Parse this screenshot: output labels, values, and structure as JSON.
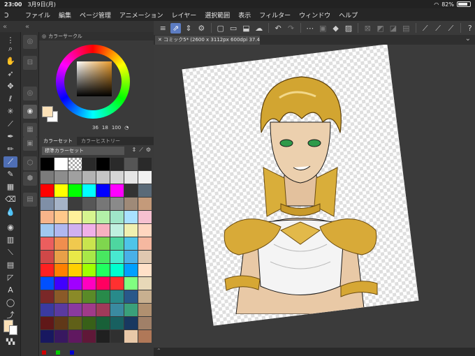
{
  "status": {
    "time": "23:00",
    "date": "3月9日(月)",
    "battery": "82%",
    "battery_level": 0.82
  },
  "menu": [
    "ファイル",
    "編集",
    "ページ管理",
    "アニメーション",
    "レイヤー",
    "選択範囲",
    "表示",
    "フィルター",
    "ウィンドウ",
    "ヘルプ"
  ],
  "tab": {
    "title": "コミック5* (2600 x 3112px 600dpi 37.4%)"
  },
  "color_wheel": {
    "title": "カラーサークル",
    "values": [
      "36",
      "18",
      "100"
    ]
  },
  "color_set": {
    "tabs": [
      "カラーセット",
      "カラーヒストリー"
    ],
    "selected_set": "標準カラーセット",
    "swatches": [
      "#000000",
      "#ffffff",
      "checker",
      "#2a2a2a",
      "#000000",
      "#2a2a2a",
      "#555555",
      "#2a2a2a",
      "#7b7b7b",
      "#8d8d8d",
      "#a0a0a0",
      "#b3b3b3",
      "#c6c6c6",
      "#d6d6d6",
      "#e6e6e6",
      "#f2f2f2",
      "#ff0000",
      "#ffff00",
      "#00ff00",
      "#00ffff",
      "#0000ff",
      "#ff00ff",
      "#333333",
      "#5a6a78",
      "#7f8fa7",
      "#a5b3c7",
      "#3d3d3d",
      "#575757",
      "#777777",
      "#8a8a8a",
      "#9f8a78",
      "#c49a7a",
      "#f7b48a",
      "#ffc88a",
      "#fff09a",
      "#d6f58f",
      "#b3f0a8",
      "#9fe6c8",
      "#a8e1ff",
      "#f6c0d0",
      "#a0c8f0",
      "#b0b8f0",
      "#d0b0f0",
      "#f0b0e8",
      "#f7b0c0",
      "#c0f0e0",
      "#f0f0b0",
      "#ffd6c0",
      "#ec5e5e",
      "#f08e4e",
      "#f0c94e",
      "#c9e44e",
      "#7fd64e",
      "#4ed6a0",
      "#4ec4e8",
      "#f5b8a0",
      "#d04848",
      "#e8a048",
      "#e8e848",
      "#a8e848",
      "#48e860",
      "#48e8d0",
      "#48b0e8",
      "#e0c8b0",
      "#ff2020",
      "#ff8000",
      "#ffd000",
      "#a0ff00",
      "#20ff60",
      "#00ffd0",
      "#00a0ff",
      "#ffe0c8",
      "#0050ff",
      "#4000ff",
      "#a000ff",
      "#ff00c0",
      "#ff0060",
      "#ff3030",
      "#80ff80",
      "#e8d8b8",
      "#7a2828",
      "#8a5a28",
      "#8a8a28",
      "#5a8a28",
      "#288a4a",
      "#288a8a",
      "#28588a",
      "#c8b090",
      "#3a3aa0",
      "#5a3aa0",
      "#8a3aa0",
      "#a03a8a",
      "#a03a5a",
      "#3a8aa0",
      "#3aa07a",
      "#b09070",
      "#601818",
      "#603818",
      "#606018",
      "#386018",
      "#186038",
      "#186060",
      "#183860",
      "#a08068",
      "#181860",
      "#381860",
      "#601860",
      "#601838",
      "#202020",
      "#303030",
      "#e8c8a8",
      "#b07858"
    ]
  }
}
